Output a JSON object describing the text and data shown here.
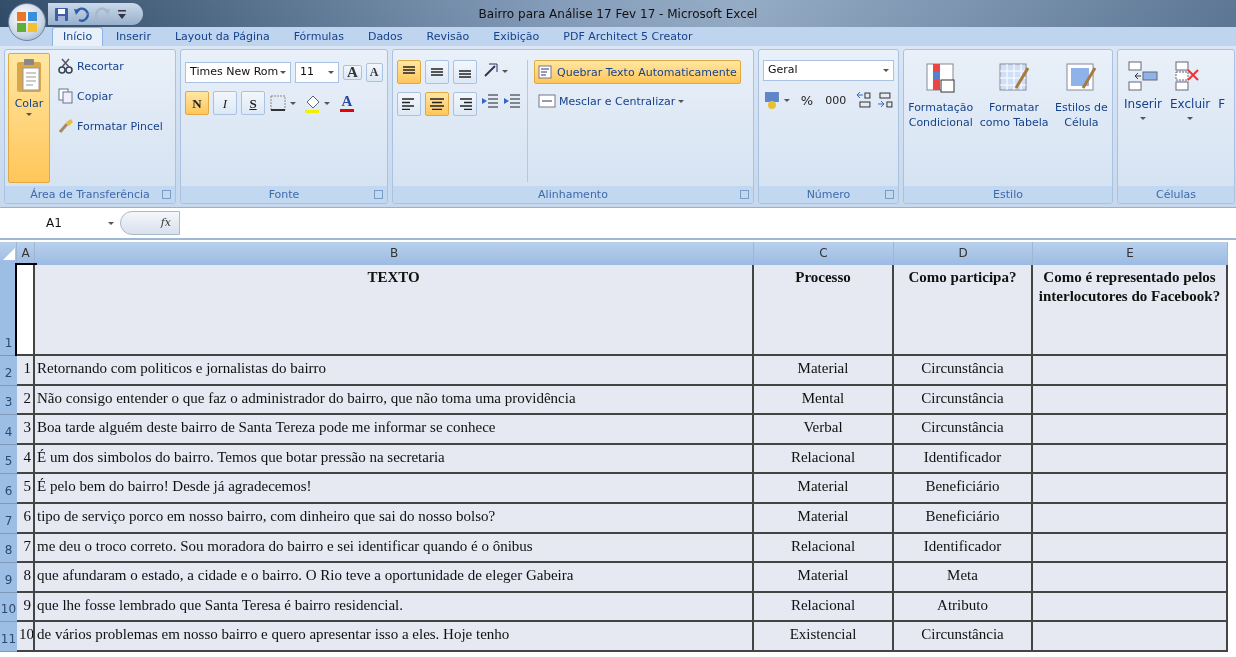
{
  "window": {
    "title": "Bairro para Análise 17 Fev 17 - Microsoft Excel"
  },
  "tabs": [
    {
      "label": "Início",
      "selected": true
    },
    {
      "label": "Inserir",
      "selected": false
    },
    {
      "label": "Layout da Página",
      "selected": false
    },
    {
      "label": "Fórmulas",
      "selected": false
    },
    {
      "label": "Dados",
      "selected": false
    },
    {
      "label": "Revisão",
      "selected": false
    },
    {
      "label": "Exibição",
      "selected": false
    },
    {
      "label": "PDF Architect 5 Creator",
      "selected": false
    }
  ],
  "clipboard": {
    "paste_label": "Colar",
    "items": [
      "Recortar",
      "Copiar",
      "Formatar Pincel"
    ],
    "label": "Área de Transferência"
  },
  "font": {
    "font_name": "Times New Rom",
    "font_size": "11",
    "grow_glyph": "A",
    "shrink_glyph": "A",
    "format_buttons": [
      {
        "kind": "bold",
        "glyph": "N",
        "active": true
      },
      {
        "kind": "italic",
        "glyph": "I",
        "active": false
      },
      {
        "kind": "underline",
        "glyph": "S",
        "active": false
      }
    ],
    "font_color_glyph": "A",
    "label": "Fonte"
  },
  "alignment": {
    "vertical": [
      {
        "kind": "top",
        "active": true
      },
      {
        "kind": "middle",
        "active": false
      },
      {
        "kind": "bottom",
        "active": false
      }
    ],
    "horizontal": [
      {
        "kind": "left",
        "active": false
      },
      {
        "kind": "center",
        "active": true
      },
      {
        "kind": "right",
        "active": false
      }
    ],
    "wrap": {
      "label": "Quebrar Texto Automaticamente",
      "active": true
    },
    "merge_label": "Mesclar e Centralizar",
    "label": "Alinhamento"
  },
  "number": {
    "format": "Geral",
    "percent": "%",
    "thousands": "000",
    "label": "Número"
  },
  "styles": {
    "buttons": [
      [
        "Formatação",
        "Condicional"
      ],
      [
        "Formatar",
        "como Tabela"
      ],
      [
        "Estilos de",
        "Célula"
      ]
    ],
    "label": "Estilo"
  },
  "cells": {
    "buttons": [
      "Inserir",
      "Excluir",
      "F"
    ],
    "label": "Células"
  },
  "formula_bar": {
    "name_box": "A1",
    "fx": "fx"
  },
  "sheet": {
    "columns": [
      "A",
      "B",
      "C",
      "D",
      "E"
    ],
    "header_row": {
      "row": "1",
      "cell_a_selected": true,
      "texto": "TEXTO",
      "processo": "Processo",
      "participa": "Como participa?",
      "representado": "Como é representado pelos interlocutores do Facebook?"
    },
    "rows": [
      {
        "row": "2",
        "num": "1",
        "texto": "Retornando com politicos e jornalistas do bairro",
        "processo": "Material",
        "participa": "Circunstância"
      },
      {
        "row": "3",
        "num": "2",
        "texto": "Não consigo entender o que faz o administrador do bairro, que não toma uma providência",
        "processo": "Mental",
        "participa": "Circunstância"
      },
      {
        "row": "4",
        "num": "3",
        "texto": "Boa tarde alguém deste bairro de Santa Tereza pode me informar se conhece",
        "processo": "Verbal",
        "participa": "Circunstância"
      },
      {
        "row": "5",
        "num": "4",
        "texto": "É um dos simbolos do bairro. Temos que botar pressão na secretaria",
        "processo": "Relacional",
        "participa": "Identificador"
      },
      {
        "row": "6",
        "num": "5",
        "texto": "É pelo bem do bairro! Desde já agradecemos!",
        "processo": "Material",
        "participa": "Beneficiário"
      },
      {
        "row": "7",
        "num": "6",
        "texto": "tipo de serviço porco em nosso bairro, com dinheiro que sai do nosso bolso?",
        "processo": "Material",
        "participa": "Beneficiário"
      },
      {
        "row": "8",
        "num": "7",
        "texto": "me deu o troco correto. Sou moradora do bairro e sei identificar quando é o ônibus",
        "processo": "Relacional",
        "participa": "Identificador"
      },
      {
        "row": "9",
        "num": "8",
        "texto": "que afundaram o estado, a cidade e o bairro. O Rio teve a oportunidade de eleger Gabeira",
        "processo": "Material",
        "participa": "Meta"
      },
      {
        "row": "10",
        "num": "9",
        "texto": "que lhe fosse lembrado que Santa Teresa é bairro residencial.",
        "processo": "Relacional",
        "participa": "Atributo"
      },
      {
        "row": "11",
        "num": "10",
        "texto": "de vários problemas em nosso bairro e quero apresentar isso a eles. Hoje tenho",
        "processo": "Existencial",
        "participa": "Circunstância"
      }
    ]
  }
}
